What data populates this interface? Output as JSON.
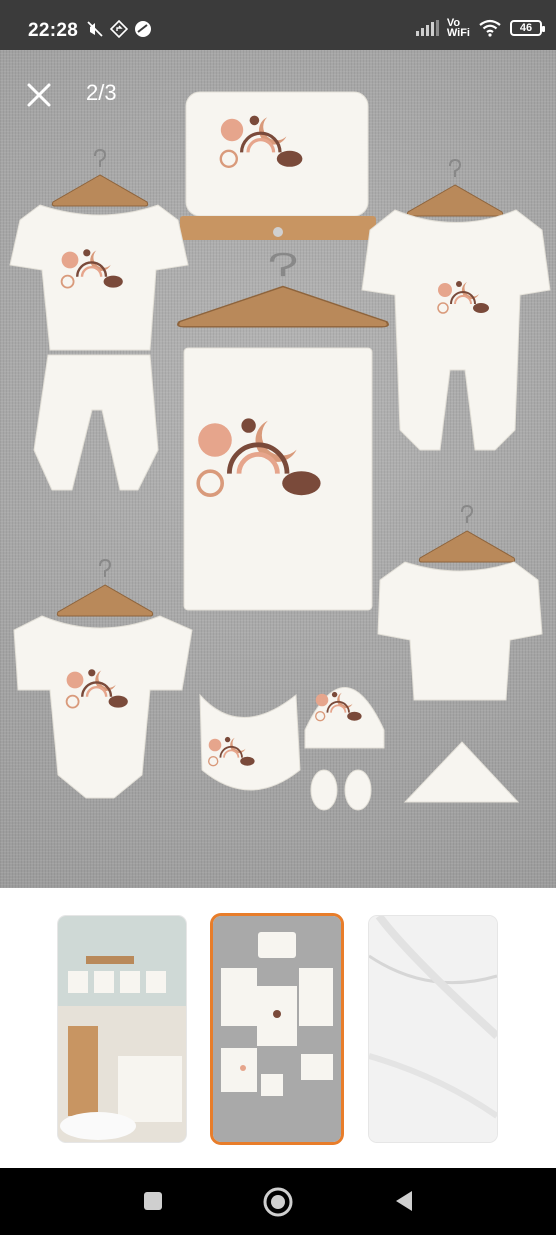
{
  "status_bar": {
    "time": "22:28",
    "network_label_top": "Vo",
    "network_label_bottom": "WiFi",
    "battery_level": "46",
    "icons": [
      "mute-icon",
      "navigation-icon",
      "data-saver-icon",
      "signal-icon",
      "wifi-icon",
      "battery-icon"
    ]
  },
  "viewer": {
    "counter": "2/3",
    "close_icon": "close-icon",
    "current_index": 2,
    "total_images": 3
  },
  "thumbnails": [
    {
      "name": "nursery-photo",
      "selected": false
    },
    {
      "name": "baby-set-layout",
      "selected": true
    },
    {
      "name": "fabric-closeup",
      "selected": false
    }
  ],
  "colors": {
    "accent": "#e87d2a",
    "status_bar_bg": "#3b3b3b",
    "viewer_bg": "#a9a9a9",
    "garment_white": "#f7f5f0",
    "motif_peach": "#e6a58c",
    "motif_brown": "#7a4a3a",
    "hanger_wood": "#b9895a"
  },
  "nav_bar": {
    "buttons": [
      "recent-apps-icon",
      "home-icon",
      "back-icon"
    ]
  }
}
